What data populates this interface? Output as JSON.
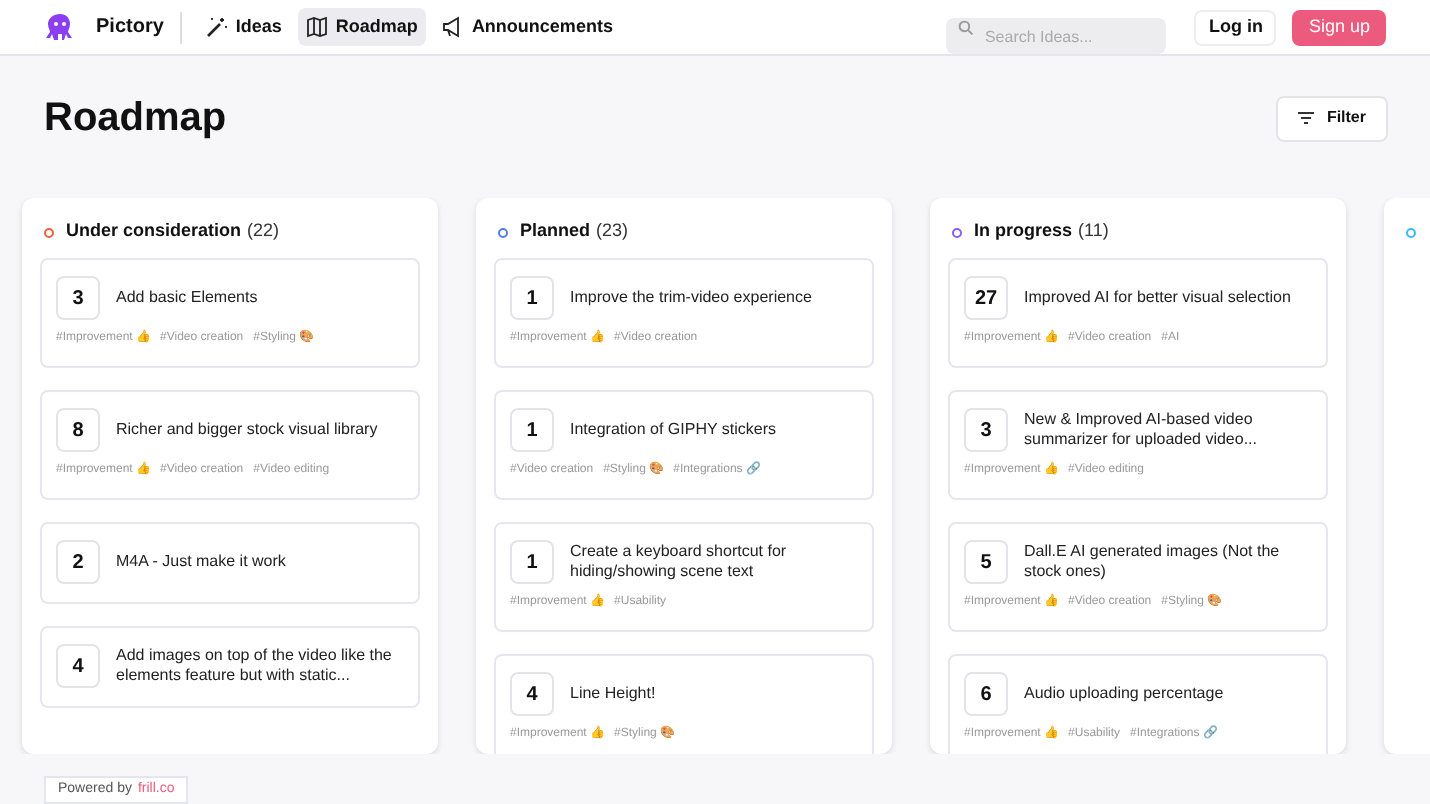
{
  "nav": {
    "brand": "Pictory",
    "links": [
      {
        "label": "Ideas",
        "selected": false
      },
      {
        "label": "Roadmap",
        "selected": true
      },
      {
        "label": "Announcements",
        "selected": false
      }
    ],
    "search": {
      "placeholder": "Search Ideas..."
    },
    "login": "Log in",
    "signup": "Sign up"
  },
  "page": {
    "title": "Roadmap",
    "filter": "Filter"
  },
  "columns": [
    {
      "title": "Under consideration",
      "count": "(22)",
      "color": "#f0603c",
      "cards": [
        {
          "votes": "3",
          "title": "Add basic Elements",
          "tags": [
            "#Improvement 👍",
            "#Video creation",
            "#Styling 🎨"
          ]
        },
        {
          "votes": "8",
          "title": "Richer and bigger stock visual library",
          "tags": [
            "#Improvement 👍",
            "#Video creation",
            "#Video editing"
          ]
        },
        {
          "votes": "2",
          "title": "M4A - Just make it work"
        },
        {
          "votes": "4",
          "title": "Add images on top of the video like the elements feature but with static..."
        }
      ]
    },
    {
      "title": "Planned",
      "count": "(23)",
      "color": "#4f7fe8",
      "cards": [
        {
          "votes": "1",
          "title": "Improve the trim-video experience",
          "tags": [
            "#Improvement 👍",
            "#Video creation"
          ]
        },
        {
          "votes": "1",
          "title": "Integration of GIPHY stickers",
          "tags": [
            "#Video creation",
            "#Styling 🎨",
            "#Integrations 🔗"
          ]
        },
        {
          "votes": "1",
          "title": "Create a keyboard shortcut for hiding/showing scene text",
          "tags": [
            "#Improvement 👍",
            "#Usability"
          ]
        },
        {
          "votes": "4",
          "title": "Line Height!",
          "tags": [
            "#Improvement 👍",
            "#Styling 🎨"
          ]
        }
      ]
    },
    {
      "title": "In progress",
      "count": "(11)",
      "color": "#8b5cf6",
      "cards": [
        {
          "votes": "27",
          "title": "Improved AI for better visual selection",
          "tags": [
            "#Improvement 👍",
            "#Video creation",
            "#AI"
          ]
        },
        {
          "votes": "3",
          "title": "New & Improved AI-based video summarizer for uploaded video...",
          "tags": [
            "#Improvement 👍",
            "#Video editing"
          ]
        },
        {
          "votes": "5",
          "title": "Dall.E AI generated images (Not the stock ones)",
          "tags": [
            "#Improvement 👍",
            "#Video creation",
            "#Styling 🎨"
          ]
        },
        {
          "votes": "6",
          "title": "Audio uploading percentage",
          "tags": [
            "#Improvement 👍",
            "#Usability",
            "#Integrations 🔗"
          ]
        }
      ]
    },
    {
      "color": "#38bdf8"
    }
  ],
  "footer": {
    "text": "Powered by",
    "link": "frill.co"
  }
}
